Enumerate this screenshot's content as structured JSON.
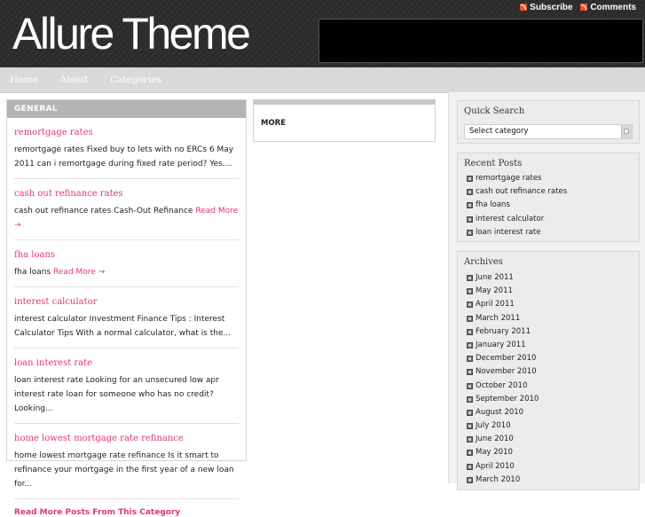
{
  "header": {
    "logo": "Allure Theme",
    "subscribe": "Subscribe",
    "comments": "Comments"
  },
  "nav": [
    "Home",
    "About",
    "Categories"
  ],
  "general": {
    "title": "GENERAL",
    "posts": [
      {
        "title": "remortgage rates",
        "excerpt": "remortgage rates Fixed buy to lets with no ERCs 6 May 2011 can i remortgage during fixed rate period? Yes....",
        "readmore": ""
      },
      {
        "title": "cash out refinance rates",
        "excerpt": "cash out refinance rates Cash-Out Refinance",
        "readmore": "Read More →"
      },
      {
        "title": "fha loans",
        "excerpt": "fha loans",
        "readmore": "Read More →"
      },
      {
        "title": "interest calculator",
        "excerpt": "interest calculator Investment Finance Tips : Interest Calculator Tips With a normal calculator, what is the...",
        "readmore": ""
      },
      {
        "title": "loan interest rate",
        "excerpt": "loan interest rate Looking for an unsecured low apr interest rate loan for someone who has no credit? Looking...",
        "readmore": ""
      },
      {
        "title": "home lowest mortgage rate refinance",
        "excerpt": "home lowest mortgage rate refinance Is it smart to refinance your mortgage in the first year of a new loan for...",
        "readmore": ""
      }
    ],
    "more_posts": "Read More Posts From This Category"
  },
  "more": {
    "title": "MORE"
  },
  "sidebar": {
    "quick_search": {
      "title": "Quick Search",
      "select": "Select category"
    },
    "recent_posts": {
      "title": "Recent Posts",
      "items": [
        "remortgage rates",
        "cash out refinance rates",
        "fha loans",
        "interest calculator",
        "loan interest rate"
      ]
    },
    "archives": {
      "title": "Archives",
      "items": [
        "June 2011",
        "May 2011",
        "April 2011",
        "March 2011",
        "February 2011",
        "January 2011",
        "December 2010",
        "November 2010",
        "October 2010",
        "September 2010",
        "August 2010",
        "July 2010",
        "June 2010",
        "May 2010",
        "April 2010",
        "March 2010"
      ]
    }
  }
}
